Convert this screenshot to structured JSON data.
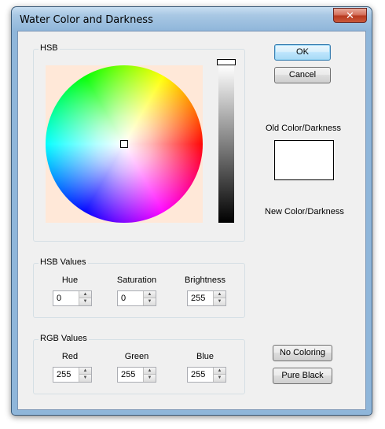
{
  "window": {
    "title": "Water Color and Darkness",
    "close_glyph": "✕"
  },
  "hsb_group": {
    "label": "HSB"
  },
  "buttons": {
    "ok": "OK",
    "cancel": "Cancel",
    "no_coloring": "No Coloring",
    "pure_black": "Pure Black"
  },
  "labels": {
    "old_color": "Old Color/Darkness",
    "new_color": "New Color/Darkness"
  },
  "preview": {
    "old_color": "#ffffff"
  },
  "hsb_values": {
    "label": "HSB Values",
    "hue": {
      "label": "Hue",
      "value": "0"
    },
    "saturation": {
      "label": "Saturation",
      "value": "0"
    },
    "brightness": {
      "label": "Brightness",
      "value": "255"
    }
  },
  "rgb_values": {
    "label": "RGB Values",
    "red": {
      "label": "Red",
      "value": "255"
    },
    "green": {
      "label": "Green",
      "value": "255"
    },
    "blue": {
      "label": "Blue",
      "value": "255"
    }
  },
  "icons": {
    "spin_up": "▲",
    "spin_down": "▼"
  },
  "colors": {
    "accent": "#3c7fb1",
    "close": "#c9583a"
  }
}
